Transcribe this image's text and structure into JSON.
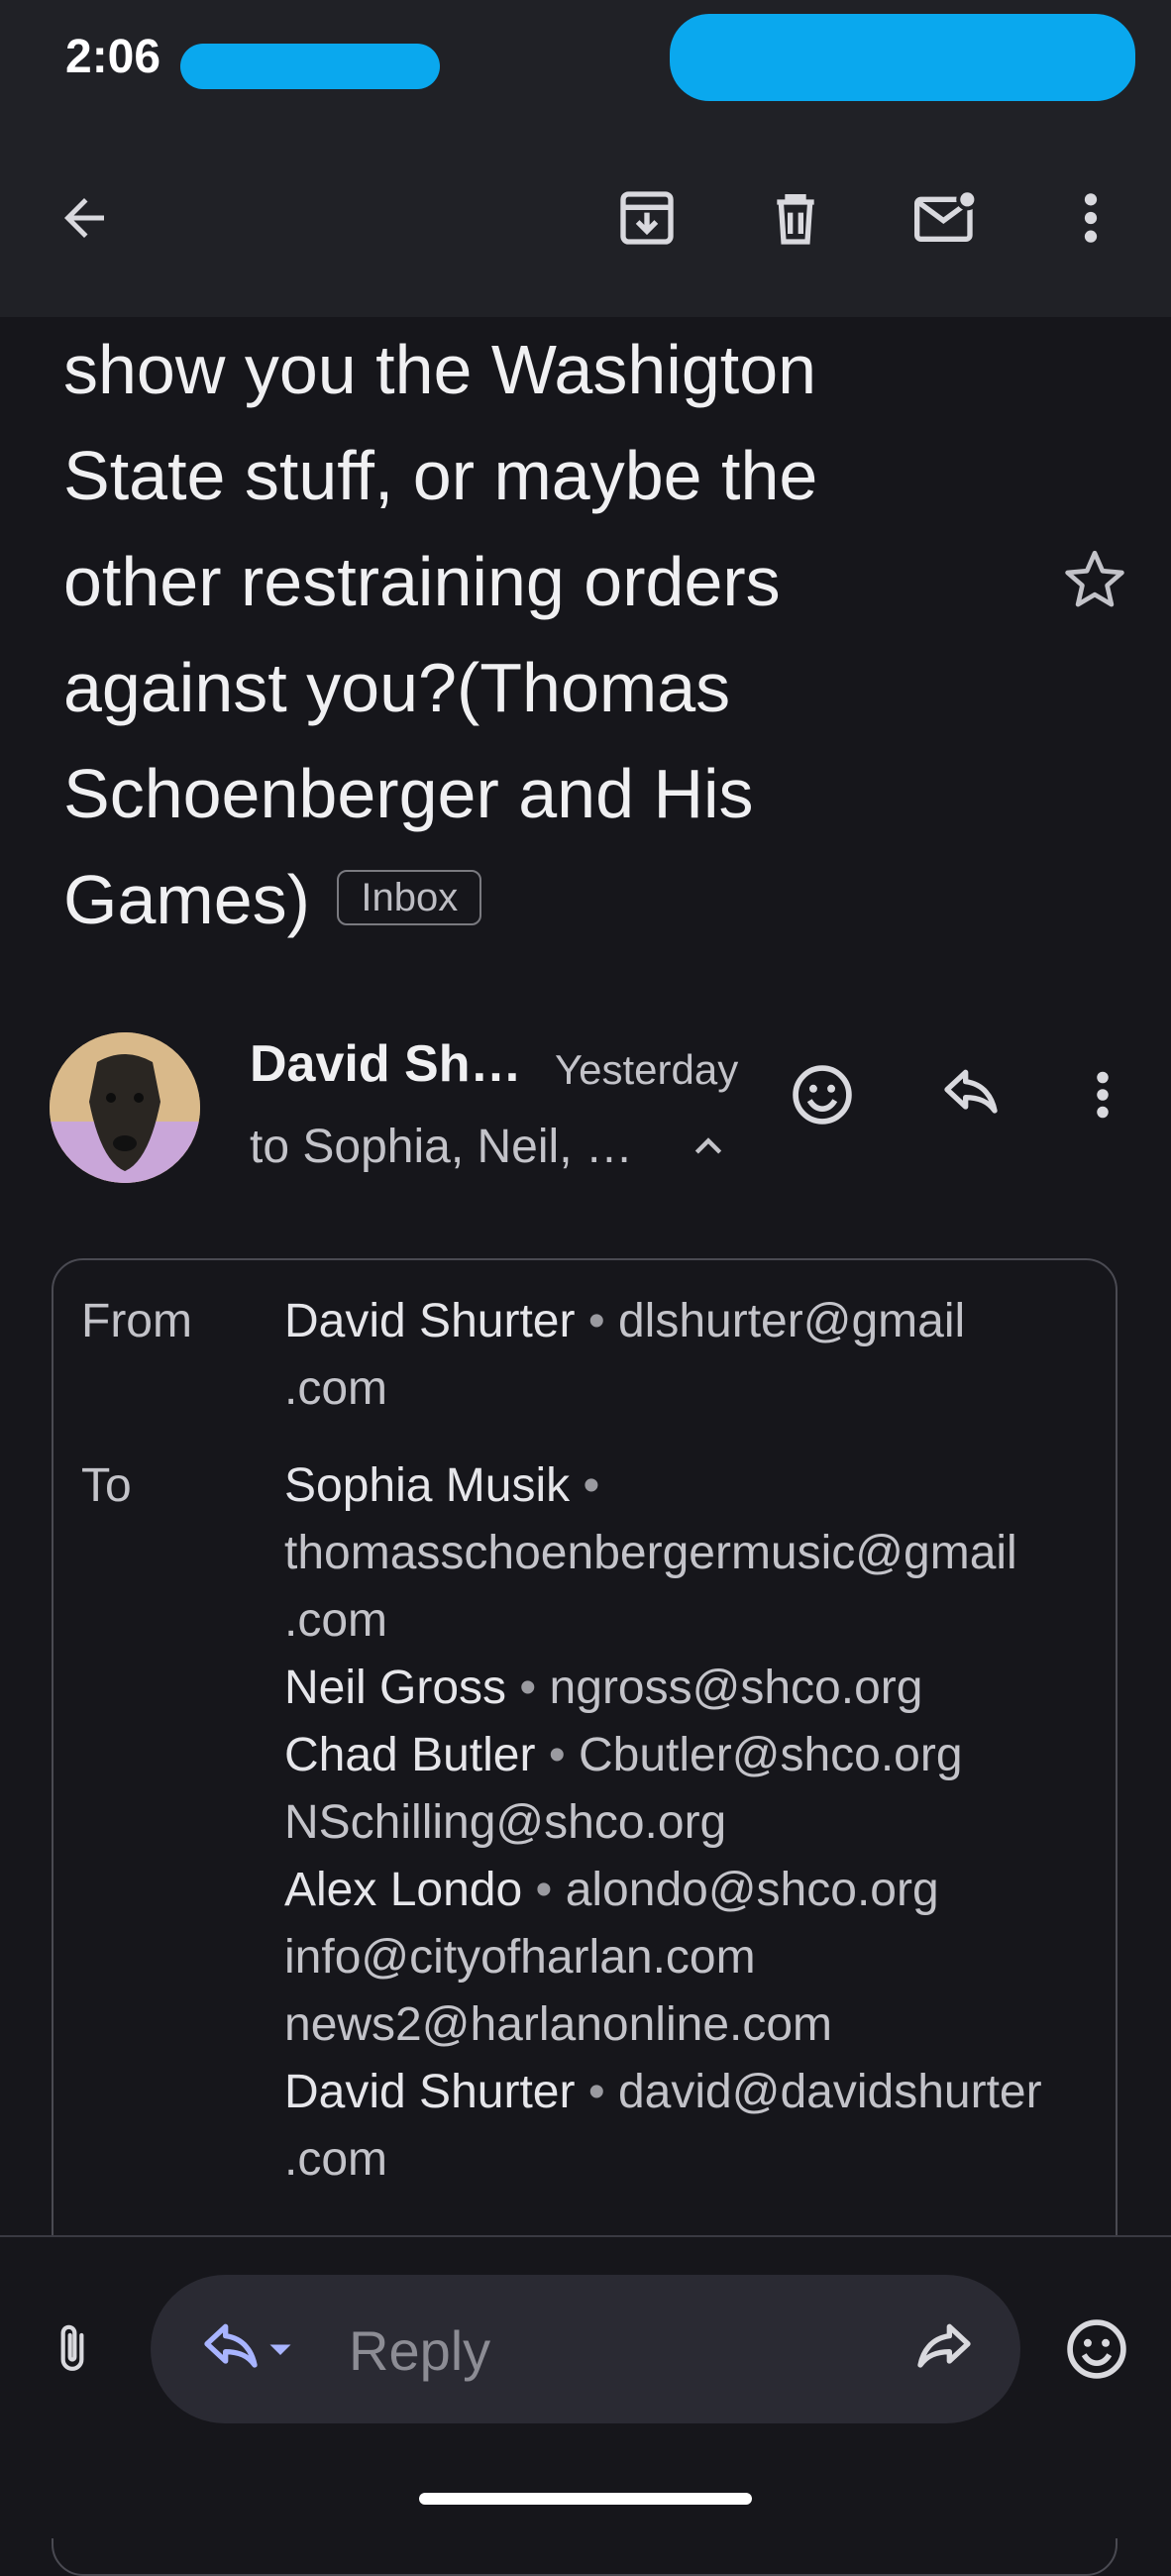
{
  "status_bar": {
    "time": "2:06"
  },
  "toolbar": {
    "back_icon": "arrow-left-icon",
    "archive_icon": "archive-icon",
    "delete_icon": "trash-icon",
    "mark_unread_icon": "mark-unread-icon",
    "more_icon": "more-vert-icon"
  },
  "email": {
    "subject_lines": [
      "show you the Washigton",
      "State stuff, or maybe the",
      "other restraining orders",
      "against you?(Thomas",
      "Schoenberger and His",
      "Games)"
    ],
    "label": "Inbox",
    "sender_short": "David Sh…",
    "date": "Yesterday",
    "to_summary": "to Sophia, Neil, …",
    "from_label": "From",
    "to_label": "To",
    "from": {
      "name": "David Shurter",
      "email_l1": "dlshurter@gmail",
      "email_l2": ".com"
    },
    "recipients": {
      "r1_name": "Sophia Musik",
      "r1_email_l1": "thomasschoenbergermusic@gmail",
      "r1_email_l2": ".com",
      "r2_name": "Neil Gross",
      "r2_email": "ngross@shco.org",
      "r3_name": "Chad Butler",
      "r3_email": "Cbutler@shco.org",
      "r4_email": "NSchilling@shco.org",
      "r5_name": "Alex Londo",
      "r5_email": "alondo@shco.org",
      "r6_email": "info@cityofharlan.com",
      "r7_email": "news2@harlanonline.com",
      "r8_name": "David Shurter",
      "r8_email_l1": "david@davidshurter",
      "r8_email_l2": ".com"
    }
  },
  "bottom_bar": {
    "reply_placeholder": "Reply"
  },
  "colors": {
    "background": "#16161b",
    "bar": "#202126",
    "accent": "#a8b4ff",
    "redaction": "#0aa8ee"
  }
}
